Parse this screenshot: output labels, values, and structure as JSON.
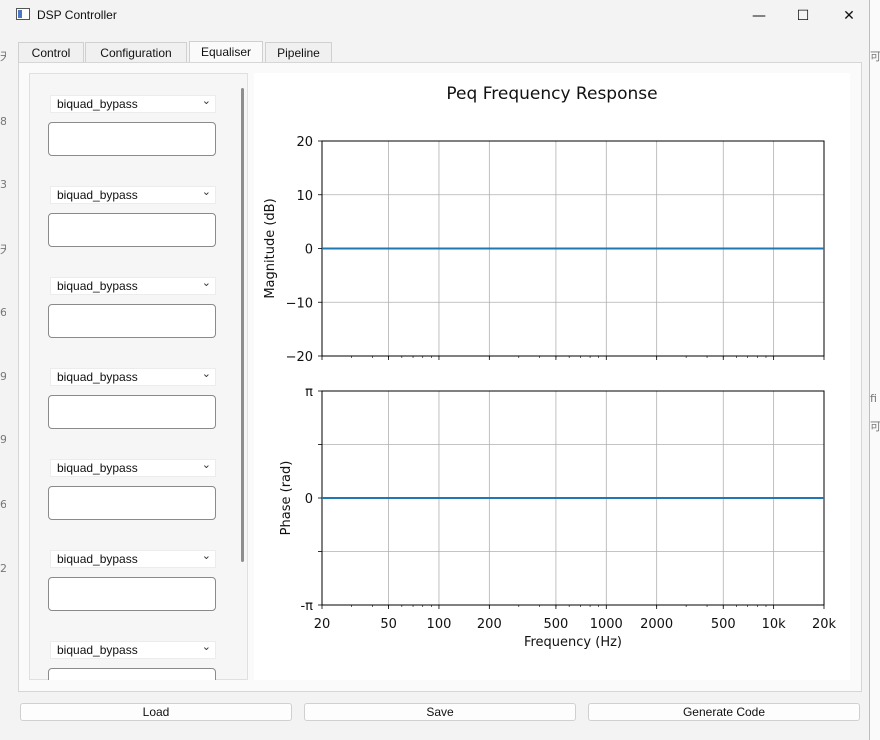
{
  "window": {
    "title": "DSP Controller"
  },
  "window_controls": {
    "minimize": "—",
    "maximize": "☐",
    "close": "✕"
  },
  "tabs": [
    {
      "label": "Control"
    },
    {
      "label": "Configuration"
    },
    {
      "label": "Equaliser",
      "active": true
    },
    {
      "label": "Pipeline"
    }
  ],
  "filters": [
    {
      "type": "biquad_bypass",
      "params": ""
    },
    {
      "type": "biquad_bypass",
      "params": ""
    },
    {
      "type": "biquad_bypass",
      "params": ""
    },
    {
      "type": "biquad_bypass",
      "params": ""
    },
    {
      "type": "biquad_bypass",
      "params": ""
    },
    {
      "type": "biquad_bypass",
      "params": ""
    },
    {
      "type": "biquad_bypass",
      "params": ""
    }
  ],
  "buttons": {
    "load": "Load",
    "save": "Save",
    "generate": "Generate Code"
  },
  "background_glyphs": [
    "天",
    "8",
    "3",
    "天",
    "6",
    "9",
    "9",
    "6",
    "2",
    "fi",
    "可",
    "可"
  ],
  "chart_data": [
    {
      "type": "line",
      "title": "Peq Frequency Response",
      "xlabel": "",
      "ylabel": "Magnitude (dB)",
      "xscale": "log",
      "xlim": [
        20,
        20000
      ],
      "ylim": [
        -20,
        20
      ],
      "yticks": [
        20,
        10,
        0,
        -10,
        -20
      ],
      "ytick_labels": [
        "20",
        "10",
        "0",
        "−10",
        "−20"
      ],
      "grid": true,
      "series": [
        {
          "x": [
            20,
            20000
          ],
          "values": [
            0,
            0
          ],
          "color": "#1f77b4"
        }
      ]
    },
    {
      "type": "line",
      "xlabel": "Frequency (Hz)",
      "ylabel": "Phase (rad)",
      "xscale": "log",
      "xlim": [
        20,
        20000
      ],
      "ylim": [
        -3.14159,
        3.14159
      ],
      "yticks": [
        3.14159,
        0,
        -3.14159
      ],
      "ytick_labels": [
        "π",
        "0",
        "-π"
      ],
      "grid": true,
      "xticks": [
        20,
        50,
        100,
        200,
        500,
        1000,
        2000,
        5000,
        10000,
        20000
      ],
      "xtick_labels": [
        "20",
        "50",
        "100",
        "200",
        "500",
        "1000",
        "2000",
        "500",
        "10k",
        "20k"
      ],
      "series": [
        {
          "x": [
            20,
            20000
          ],
          "values": [
            0,
            0
          ],
          "color": "#1f77b4"
        }
      ]
    }
  ]
}
